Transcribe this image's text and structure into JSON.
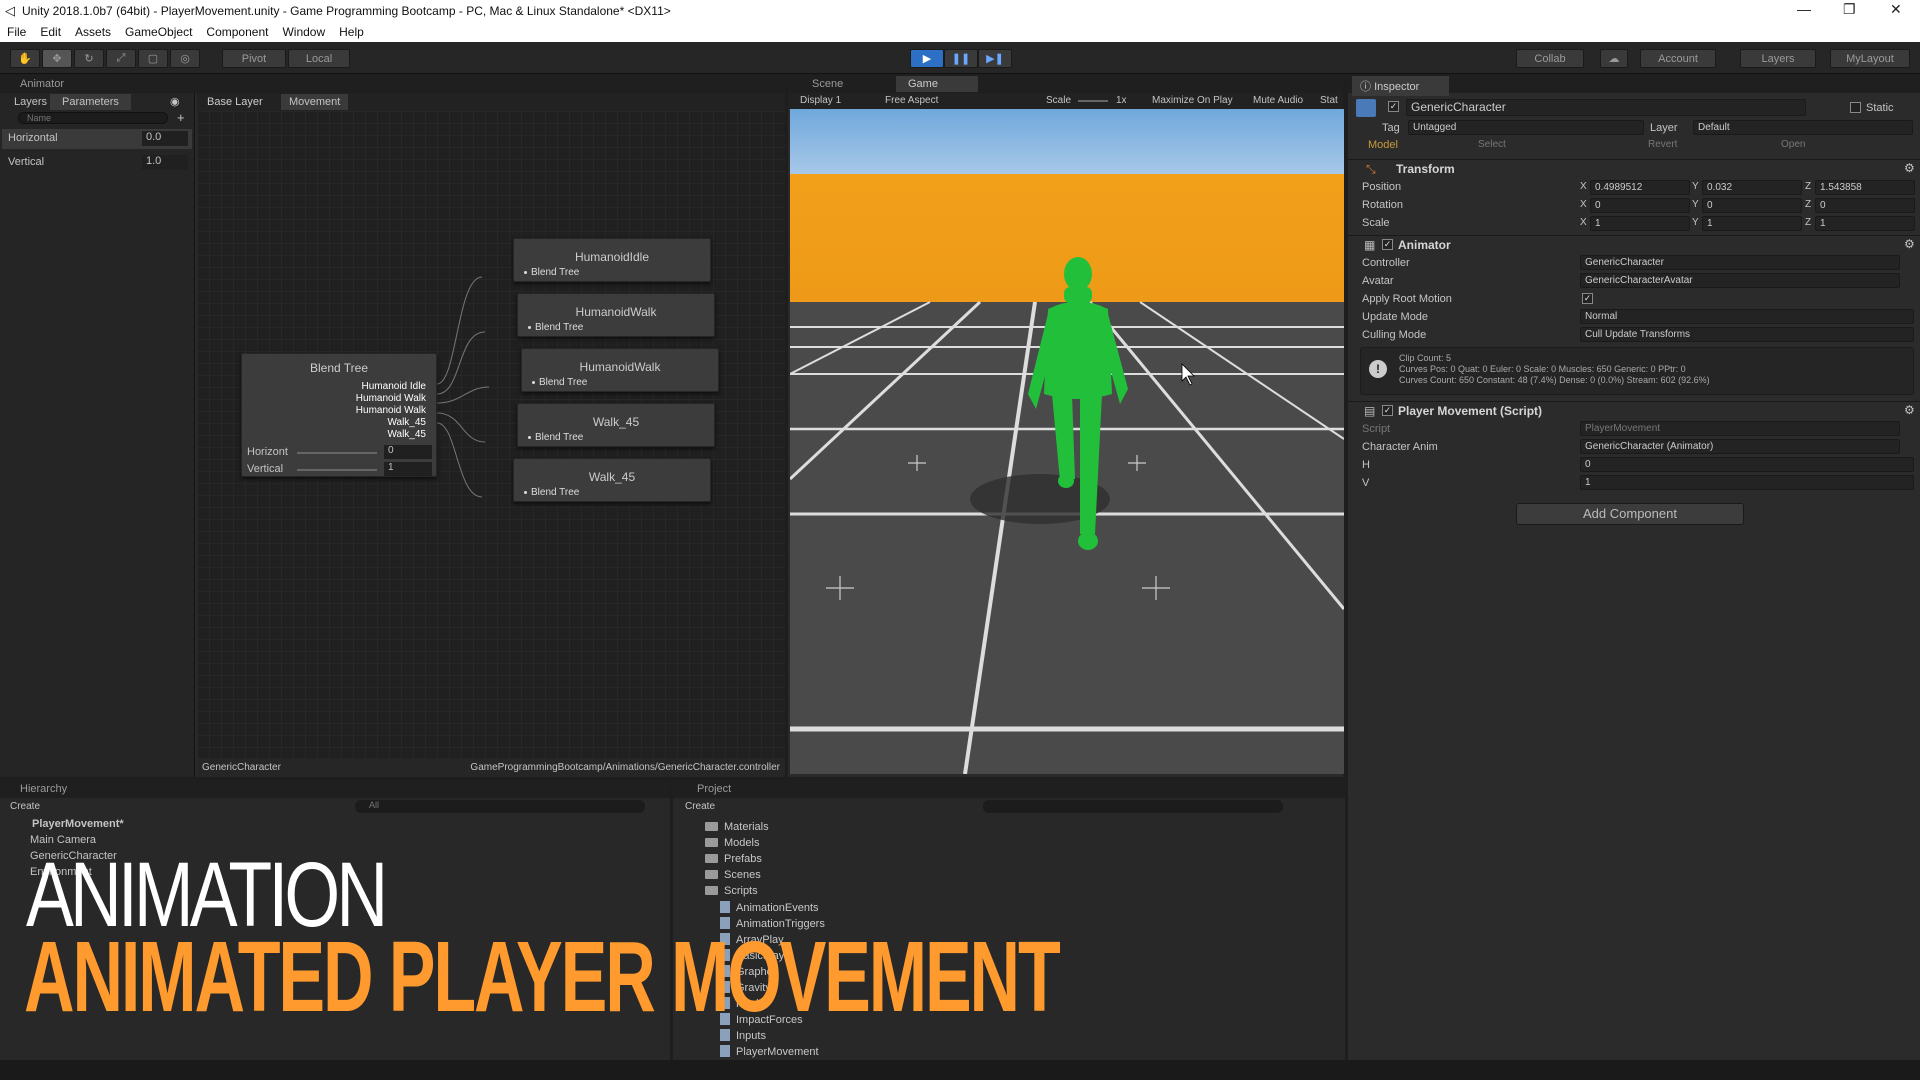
{
  "window": {
    "title": "Unity 2018.1.0b7 (64bit) - PlayerMovement.unity - Game Programming Bootcamp - PC, Mac & Linux Standalone* <DX11>"
  },
  "menu": [
    "File",
    "Edit",
    "Assets",
    "GameObject",
    "Component",
    "Window",
    "Help"
  ],
  "toolbar": {
    "pivot": "Pivot",
    "local": "Local",
    "collab": "Collab",
    "account": "Account",
    "layers": "Layers",
    "layout": "MyLayout"
  },
  "animator": {
    "tab": "Animator",
    "layers_tab": "Layers",
    "params_tab": "Parameters",
    "search_placeholder": "Name",
    "params": [
      {
        "name": "Horizontal",
        "value": "0.0"
      },
      {
        "name": "Vertical",
        "value": "1.0"
      }
    ],
    "breadcrumb": [
      "Base Layer",
      "Movement"
    ],
    "blend": {
      "title": "Blend Tree",
      "motions": [
        "Humanoid Idle",
        "Humanoid Walk",
        "Humanoid Walk",
        "Walk_45",
        "Walk_45"
      ],
      "h_label": "Horizont",
      "h_value": "0",
      "v_label": "Vertical",
      "v_value": "1"
    },
    "nodes": [
      {
        "title": "HumanoidIdle",
        "sub": "Blend Tree"
      },
      {
        "title": "HumanoidWalk",
        "sub": "Blend Tree"
      },
      {
        "title": "HumanoidWalk",
        "sub": "Blend Tree"
      },
      {
        "title": "Walk_45",
        "sub": "Blend Tree"
      },
      {
        "title": "Walk_45",
        "sub": "Blend Tree"
      }
    ],
    "footer_left": "GenericCharacter",
    "footer_right": "GameProgrammingBootcamp/Animations/GenericCharacter.controller"
  },
  "scene_tab": "Scene",
  "game_tab": "Game",
  "game_bar": {
    "display": "Display 1",
    "aspect": "Free Aspect",
    "scale_label": "Scale",
    "scale_value": "1x",
    "maximize": "Maximize On Play",
    "mute": "Mute Audio",
    "stats": "Stat"
  },
  "inspector": {
    "tab": "Inspector",
    "object": "GenericCharacter",
    "static": "Static",
    "tag_label": "Tag",
    "tag": "Untagged",
    "layer_label": "Layer",
    "layer": "Default",
    "model": "Model",
    "select": "Select",
    "revert": "Revert",
    "open": "Open",
    "transform": {
      "title": "Transform",
      "rows": [
        {
          "label": "Position",
          "x": "0.4989512",
          "y": "0.032",
          "z": "1.543858"
        },
        {
          "label": "Rotation",
          "x": "0",
          "y": "0",
          "z": "0"
        },
        {
          "label": "Scale",
          "x": "1",
          "y": "1",
          "z": "1"
        }
      ]
    },
    "animator": {
      "title": "Animator",
      "controller_label": "Controller",
      "controller": "GenericCharacter",
      "avatar_label": "Avatar",
      "avatar": "GenericCharacterAvatar",
      "root_label": "Apply Root Motion",
      "update_label": "Update Mode",
      "update": "Normal",
      "culling_label": "Culling Mode",
      "culling": "Cull Update Transforms",
      "info": [
        "Clip Count: 5",
        "Curves Pos: 0 Quat: 0 Euler: 0 Scale: 0 Muscles: 650 Generic: 0 PPtr: 0",
        "Curves Count: 650 Constant: 48 (7.4%) Dense: 0 (0.0%) Stream: 602 (92.6%)"
      ]
    },
    "script": {
      "title": "Player Movement (Script)",
      "script_label": "Script",
      "script": "PlayerMovement",
      "anim_label": "Character Anim",
      "anim": "GenericCharacter (Animator)",
      "h_label": "H",
      "h": "0",
      "v_label": "V",
      "v": "1"
    },
    "add_component": "Add Component"
  },
  "hierarchy": {
    "tab": "Hierarchy",
    "create": "Create",
    "search": "All",
    "scene": "PlayerMovement*",
    "items": [
      "Main Camera",
      "GenericCharacter",
      "Environment"
    ]
  },
  "project": {
    "tab": "Project",
    "create": "Create",
    "folders": [
      "Materials",
      "Models",
      "Prefabs",
      "Scenes",
      "Scripts"
    ],
    "scripts": [
      "AnimationEvents",
      "AnimationTriggers",
      "ArrayPlay",
      "BasicPlay",
      "Grapher",
      "Gravity",
      "Health",
      "ImpactForces",
      "Inputs",
      "PlayerMovement"
    ]
  },
  "overlay": {
    "line1": "ANIMATION",
    "line2": "ANIMATED PLAYER MOVEMENT"
  },
  "colors": {
    "sky": "#6fa8dc",
    "horizon": "#f0a020",
    "ground": "#4a4a4a",
    "character": "#22c03a",
    "accent": "#ff9b2e"
  }
}
